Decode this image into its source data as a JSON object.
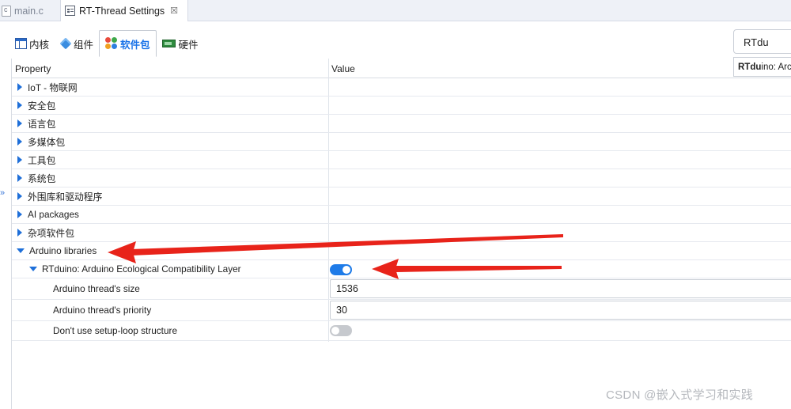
{
  "editor_tabs": [
    {
      "label": "main.c",
      "icon": "c-file-icon",
      "active": false
    },
    {
      "label": "RT-Thread Settings",
      "icon": "settings-file-icon",
      "active": true,
      "close": "☒"
    }
  ],
  "category_tabs": [
    {
      "label": "内核",
      "icon": "kernel-icon"
    },
    {
      "label": "组件",
      "icon": "component-icon"
    },
    {
      "label": "软件包",
      "icon": "package-icon",
      "active": true
    },
    {
      "label": "硬件",
      "icon": "hardware-icon"
    }
  ],
  "search": {
    "value": "RTdu"
  },
  "suggestion": {
    "match": "RTdu",
    "rest": "ino: Arc"
  },
  "grid": {
    "header_property": "Property",
    "header_value": "Value",
    "categories": [
      {
        "label": "IoT - 物联网"
      },
      {
        "label": "安全包"
      },
      {
        "label": "语言包"
      },
      {
        "label": "多媒体包"
      },
      {
        "label": "工具包"
      },
      {
        "label": "系统包"
      },
      {
        "label": "外围库和驱动程序"
      },
      {
        "label": "AI packages"
      },
      {
        "label": "杂项软件包"
      }
    ],
    "arduino_libraries": {
      "label": "Arduino libraries",
      "expanded": true
    },
    "rtduino": {
      "label": "RTduino: Arduino Ecological Compatibility Layer",
      "enabled": true
    },
    "thread_size": {
      "label": "Arduino thread's size",
      "value": "1536"
    },
    "thread_priority": {
      "label": "Arduino thread's priority",
      "value": "30"
    },
    "no_setup_loop": {
      "label": "Don't use setup-loop structure",
      "enabled": false
    }
  },
  "side_collapse": "»",
  "watermark": "CSDN @嵌入式学习和实践",
  "colors": {
    "accent": "#1e7be8",
    "annotation_arrow": "#e8231a"
  }
}
